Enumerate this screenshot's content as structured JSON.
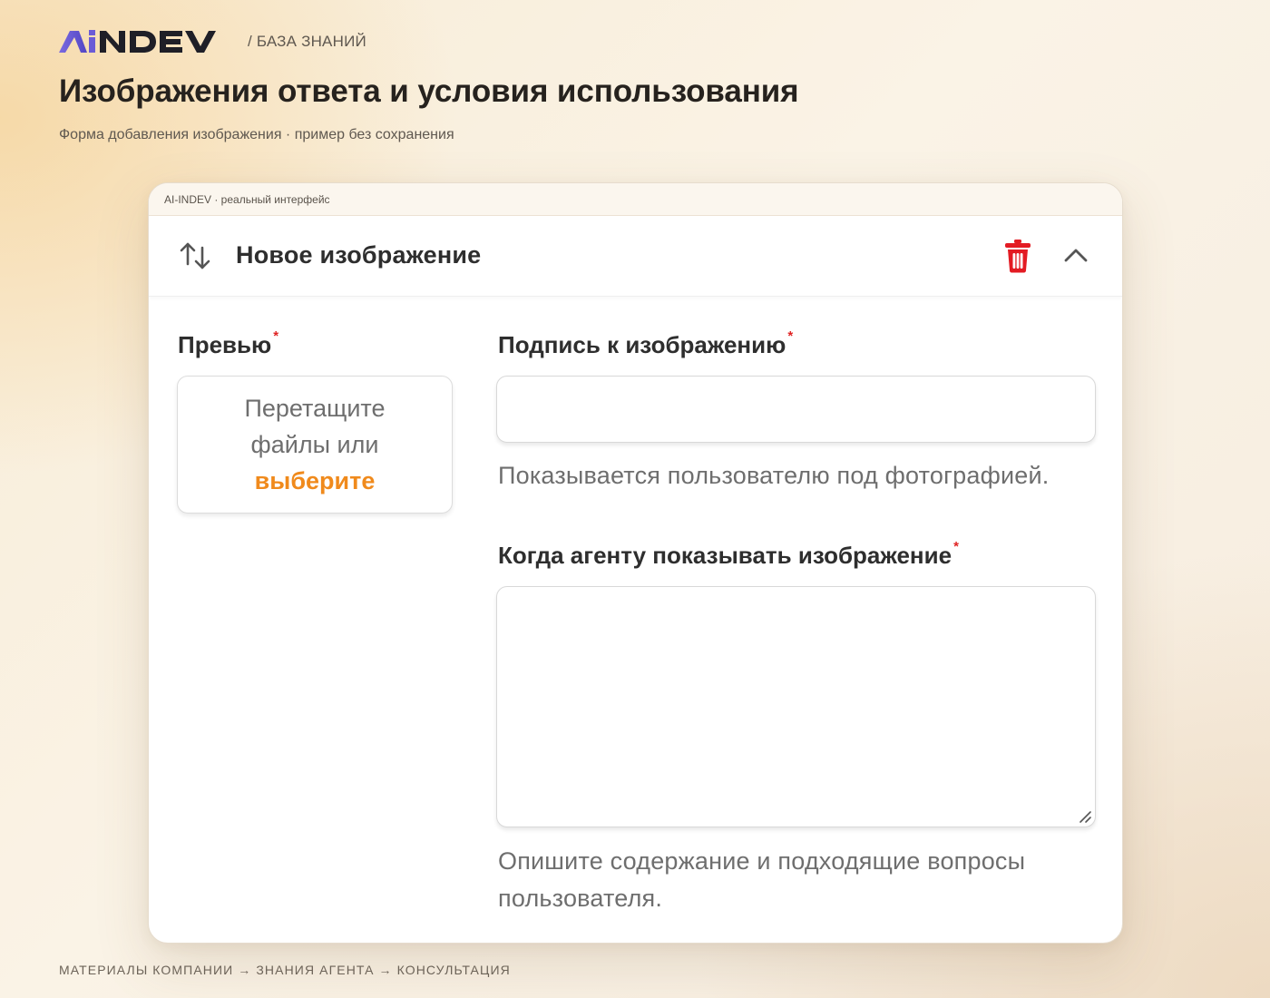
{
  "header": {
    "logo_text": "AiNDEV",
    "breadcrumb": "/ БАЗА ЗНАНИЙ",
    "title": "Изображения ответа и условия использования",
    "subtitle": "Форма добавления изображения · пример без сохранения"
  },
  "card": {
    "caption": "AI-INDEV · реальный интерфейс",
    "title": "Новое изображение",
    "icons": {
      "sort": "sort-arrows-icon",
      "delete": "trash-icon",
      "collapse": "chevron-up-icon"
    },
    "colors": {
      "delete": "#e31b23",
      "accent": "#f08a1c",
      "required": "#e02424",
      "logo_purple": "#6b5bd6"
    },
    "preview": {
      "label": "Превью",
      "required_mark": "*",
      "drop_line1": "Перетащите",
      "drop_line2": "файлы или",
      "drop_choose": "выберите"
    },
    "caption_field": {
      "label": "Подпись к изображению",
      "required_mark": "*",
      "value": "",
      "help": "Показывается пользователю под фотографией."
    },
    "when_field": {
      "label": "Когда агенту показывать изображение",
      "required_mark": "*",
      "value": "",
      "help": "Опишите содержание и подходящие вопросы пользователя."
    }
  },
  "footer": {
    "trail": "МАТЕРИАЛЫ КОМПАНИИ → ЗНАНИЯ АГЕНТА → КОНСУЛЬТАЦИЯ"
  }
}
